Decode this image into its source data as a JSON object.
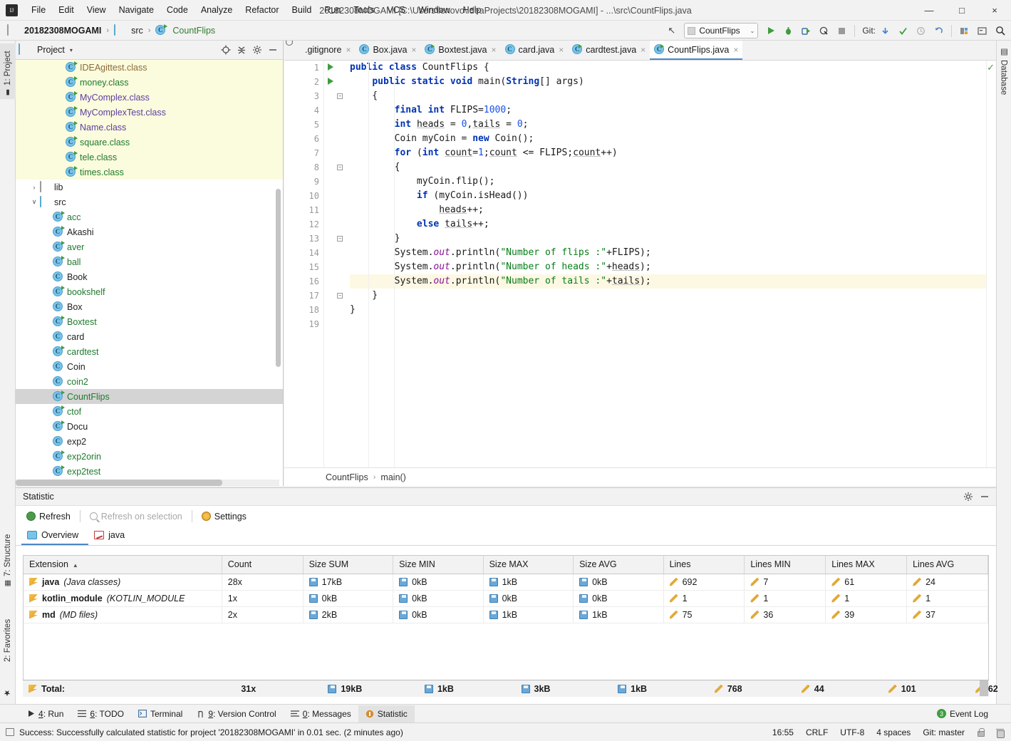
{
  "window": {
    "title": "20182308MOGAMI [C:\\Users\\lenovo\\IdeaProjects\\20182308MOGAMI] - ...\\src\\CountFlips.java",
    "minimize": "—",
    "maximize": "□",
    "close": "×"
  },
  "menu": {
    "items": [
      "File",
      "Edit",
      "View",
      "Navigate",
      "Code",
      "Analyze",
      "Refactor",
      "Build",
      "Run",
      "Tools",
      "VCS",
      "Window",
      "Help"
    ]
  },
  "navbar": {
    "crumbs": [
      {
        "label": "20182308MOGAMI",
        "icon": "module-icon"
      },
      {
        "label": "src",
        "icon": "folder-icon"
      },
      {
        "label": "CountFlips",
        "icon": "class-icon"
      }
    ],
    "separator": "›",
    "run_config": "CountFlips",
    "run_config_arrow": "⌄",
    "git_label": "Git:",
    "icons": {
      "back": "↖",
      "run": "▶",
      "debug": "debug-icon",
      "coverage": "coverage-icon",
      "profiler": "profiler-icon",
      "stop": "■",
      "update": "↓",
      "commit": "✓",
      "history": "◴",
      "rollback": "↺",
      "project_structure": "structure-icon",
      "terminal": "terminal-icon",
      "search": "⌕"
    }
  },
  "left_strip": {
    "project": "1: Project",
    "structure": "7: Structure",
    "favorites": "2: Favorites",
    "star": "★"
  },
  "right_strip": {
    "database": "Database"
  },
  "project_panel": {
    "title": "Project",
    "caret": "▾",
    "actions": [
      "locate-icon",
      "collapse-all-icon",
      "settings-icon",
      "hide-icon"
    ],
    "tree": [
      {
        "label": "IDEAgittest.class",
        "indent": 3,
        "icon": "class-run-icon",
        "color": "brown",
        "hl": true
      },
      {
        "label": "money.class",
        "indent": 3,
        "icon": "class-run-icon",
        "color": "green",
        "hl": true
      },
      {
        "label": "MyComplex.class",
        "indent": 3,
        "icon": "class-run-icon",
        "color": "purple",
        "hl": true
      },
      {
        "label": "MyComplexTest.class",
        "indent": 3,
        "icon": "class-run-icon",
        "color": "purple",
        "hl": true
      },
      {
        "label": "Name.class",
        "indent": 3,
        "icon": "class-run-icon",
        "color": "purple",
        "hl": true
      },
      {
        "label": "square.class",
        "indent": 3,
        "icon": "class-run-icon",
        "color": "green",
        "hl": true
      },
      {
        "label": "tele.class",
        "indent": 3,
        "icon": "class-run-icon",
        "color": "green",
        "hl": true
      },
      {
        "label": "times.class",
        "indent": 3,
        "icon": "class-run-icon",
        "color": "green",
        "hl": true
      },
      {
        "label": "lib",
        "indent": 1,
        "icon": "folder-grey-icon",
        "color": "dark",
        "arrow": "›"
      },
      {
        "label": "src",
        "indent": 1,
        "icon": "folder-icon",
        "color": "dark",
        "arrow": "∨"
      },
      {
        "label": "acc",
        "indent": 2,
        "icon": "class-run-icon",
        "color": "green"
      },
      {
        "label": "Akashi",
        "indent": 2,
        "icon": "class-run-icon",
        "color": "dark"
      },
      {
        "label": "aver",
        "indent": 2,
        "icon": "class-run-icon",
        "color": "green"
      },
      {
        "label": "ball",
        "indent": 2,
        "icon": "class-run-icon",
        "color": "green"
      },
      {
        "label": "Book",
        "indent": 2,
        "icon": "class-icon",
        "color": "dark"
      },
      {
        "label": "bookshelf",
        "indent": 2,
        "icon": "class-run-icon",
        "color": "green"
      },
      {
        "label": "Box",
        "indent": 2,
        "icon": "class-icon",
        "color": "dark"
      },
      {
        "label": "Boxtest",
        "indent": 2,
        "icon": "class-run-icon",
        "color": "green"
      },
      {
        "label": "card",
        "indent": 2,
        "icon": "class-icon",
        "color": "dark"
      },
      {
        "label": "cardtest",
        "indent": 2,
        "icon": "class-run-icon",
        "color": "green"
      },
      {
        "label": "Coin",
        "indent": 2,
        "icon": "class-icon",
        "color": "dark"
      },
      {
        "label": "coin2",
        "indent": 2,
        "icon": "class-icon",
        "color": "green"
      },
      {
        "label": "CountFlips",
        "indent": 2,
        "icon": "class-run-icon",
        "color": "green",
        "selected": true
      },
      {
        "label": "ctof",
        "indent": 2,
        "icon": "class-run-icon",
        "color": "green"
      },
      {
        "label": "Docu",
        "indent": 2,
        "icon": "class-run-icon",
        "color": "dark"
      },
      {
        "label": "exp2",
        "indent": 2,
        "icon": "class-icon",
        "color": "dark"
      },
      {
        "label": "exp2orin",
        "indent": 2,
        "icon": "class-run-icon",
        "color": "green"
      },
      {
        "label": "exp2test",
        "indent": 2,
        "icon": "class-run-icon",
        "color": "green"
      }
    ]
  },
  "editor": {
    "tabs": [
      {
        "label": ".gitignore",
        "icon": "gitignore-icon",
        "active": false
      },
      {
        "label": "Box.java",
        "icon": "class-icon",
        "active": false
      },
      {
        "label": "Boxtest.java",
        "icon": "class-run-icon",
        "active": false
      },
      {
        "label": "card.java",
        "icon": "class-icon",
        "active": false
      },
      {
        "label": "cardtest.java",
        "icon": "class-run-icon",
        "active": false
      },
      {
        "label": "CountFlips.java",
        "icon": "class-run-icon",
        "active": true
      }
    ],
    "tab_close": "×",
    "line_numbers": [
      1,
      2,
      3,
      4,
      5,
      6,
      7,
      8,
      9,
      10,
      11,
      12,
      13,
      14,
      15,
      16,
      17,
      18,
      19
    ],
    "code": [
      "public class CountFlips {",
      "    public static void main(String[] args)",
      "    {",
      "        final int FLIPS=1000;",
      "        int heads = 0,tails = 0;",
      "        Coin myCoin = new Coin();",
      "        for (int count=1;count <= FLIPS;count++)",
      "        {",
      "            myCoin.flip();",
      "            if (myCoin.isHead())",
      "                heads++;",
      "            else tails++;",
      "        }",
      "        System.out.println(\"Number of flips :\"+FLIPS);",
      "        System.out.println(\"Number of heads :\"+heads);",
      "        System.out.println(\"Number of tails :\"+tails);",
      "    }",
      "}",
      ""
    ],
    "highlighted_line": 16,
    "run_gutter_lines": [
      1,
      2
    ],
    "fold_lines": [
      3,
      8,
      13,
      17
    ],
    "breadcrumb": {
      "class": "CountFlips",
      "method": "main()",
      "separator": "›"
    },
    "inspection_ok": "✓"
  },
  "statistic_panel": {
    "title": "Statistic",
    "header_actions": [
      "gear-icon",
      "hide-icon"
    ],
    "toolbar": {
      "refresh": "Refresh",
      "refresh_on_selection": "Refresh on selection",
      "settings": "Settings"
    },
    "tabs": [
      {
        "label": "Overview",
        "icon": "overview-icon",
        "active": true
      },
      {
        "label": "java",
        "icon": "chart-icon",
        "active": false
      }
    ],
    "table": {
      "columns": [
        "Extension",
        "Count",
        "Size SUM",
        "Size MIN",
        "Size MAX",
        "Size AVG",
        "Lines",
        "Lines MIN",
        "Lines MAX",
        "Lines AVG"
      ],
      "sort_column": "Extension",
      "sort_arrow": "▲",
      "rows": [
        {
          "extension": "java",
          "extension_desc": "(Java classes)",
          "count": "28x",
          "size_sum": "17kB",
          "size_min": "0kB",
          "size_max": "1kB",
          "size_avg": "0kB",
          "lines": "692",
          "lines_min": "7",
          "lines_max": "61",
          "lines_avg": "24"
        },
        {
          "extension": "kotlin_module",
          "extension_desc": "(KOTLIN_MODULE",
          "count": "1x",
          "size_sum": "0kB",
          "size_min": "0kB",
          "size_max": "0kB",
          "size_avg": "0kB",
          "lines": "1",
          "lines_min": "1",
          "lines_max": "1",
          "lines_avg": "1"
        },
        {
          "extension": "md",
          "extension_desc": "(MD files)",
          "count": "2x",
          "size_sum": "2kB",
          "size_min": "0kB",
          "size_max": "1kB",
          "size_avg": "1kB",
          "lines": "75",
          "lines_min": "36",
          "lines_max": "39",
          "lines_avg": "37"
        }
      ],
      "total": {
        "label": "Total:",
        "count": "31x",
        "size_sum": "19kB",
        "size_min": "1kB",
        "size_max": "3kB",
        "size_avg": "1kB",
        "lines": "768",
        "lines_min": "44",
        "lines_max": "101",
        "lines_avg": "62"
      }
    }
  },
  "bottom_bar": {
    "buttons": [
      {
        "label": "4: Run",
        "mnemonic": "4",
        "icon": "run-icon",
        "active": false
      },
      {
        "label": "6: TODO",
        "mnemonic": "6",
        "icon": "todo-icon",
        "active": false
      },
      {
        "label": "Terminal",
        "mnemonic": "",
        "icon": "terminal-icon",
        "active": false
      },
      {
        "label": "9: Version Control",
        "mnemonic": "9",
        "icon": "vcs-icon",
        "active": false
      },
      {
        "label": "0: Messages",
        "mnemonic": "0",
        "icon": "messages-icon",
        "active": false
      },
      {
        "label": "Statistic",
        "mnemonic": "",
        "icon": "statistic-icon",
        "active": true
      }
    ],
    "event_log": {
      "label": "Event Log",
      "count": "3"
    }
  },
  "status_bar": {
    "message": "Success: Successfully calculated statistic for project '20182308MOGAMI' in 0.01 sec. (2 minutes ago)",
    "time": "16:55",
    "line_separator": "CRLF",
    "encoding": "UTF-8",
    "indent": "4 spaces",
    "branch": "Git: master"
  },
  "colors": {
    "accent_blue": "#4a88c7",
    "highlight_yellow": "#fbfbdd",
    "selection_grey": "#d4d4d4",
    "keyword_blue": "#0033b3",
    "string_green": "#067d17",
    "number_blue": "#1750eb",
    "field_purple": "#871094",
    "run_green": "#3f9c3f"
  }
}
